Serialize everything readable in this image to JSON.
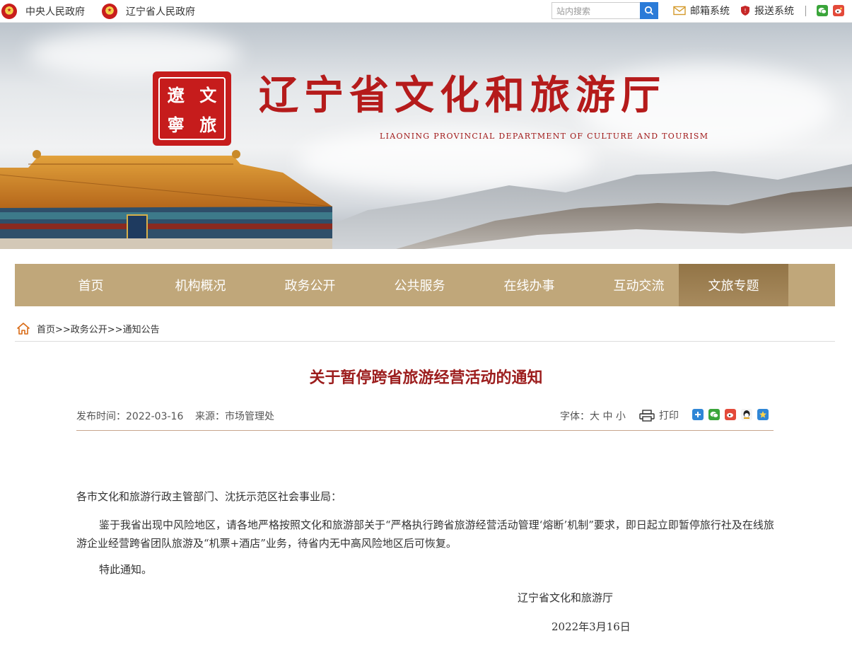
{
  "topbar": {
    "link1": "中央人民政府",
    "link2": "辽宁省人民政府",
    "search_placeholder": "站内搜索",
    "mail": "邮箱系统",
    "report": "报送系统"
  },
  "banner": {
    "seal_chars": [
      "遼",
      "文",
      "寧",
      "旅"
    ],
    "title": "辽宁省文化和旅游厅",
    "subtitle": "LIAONING PROVINCIAL DEPARTMENT OF CULTURE AND TOURISM"
  },
  "nav": [
    "首页",
    "机构概况",
    "政务公开",
    "公共服务",
    "在线办事",
    "互动交流",
    "文旅专题"
  ],
  "breadcrumb": "首页>>政务公开>>通知公告",
  "article": {
    "title": "关于暂停跨省旅游经营活动的通知",
    "date": "发布时间：2022-03-16",
    "source": "来源：市场管理处",
    "font_size": "字体：大 中 小",
    "print": "打印",
    "salutation": "各市文化和旅游行政主管部门、沈抚示范区社会事业局：",
    "paragraph": "鉴于我省出现中风险地区，请各地严格按照文化和旅游部关于“严格执行跨省旅游经营活动管理‘熔断’机制”要求，即日起立即暂停旅行社及在线旅游企业经营跨省团队旅游及“机票+酒店”业务，待省内无中高风险地区后可恢复。",
    "closing": "特此通知。",
    "signature": "辽宁省文化和旅游厅",
    "sign_date": "2022年3月16日"
  },
  "colors": {
    "nav": "#c0a77a",
    "nav_active": "#927446",
    "title": "#9c1d1d",
    "brand_red": "#c61c1c"
  }
}
